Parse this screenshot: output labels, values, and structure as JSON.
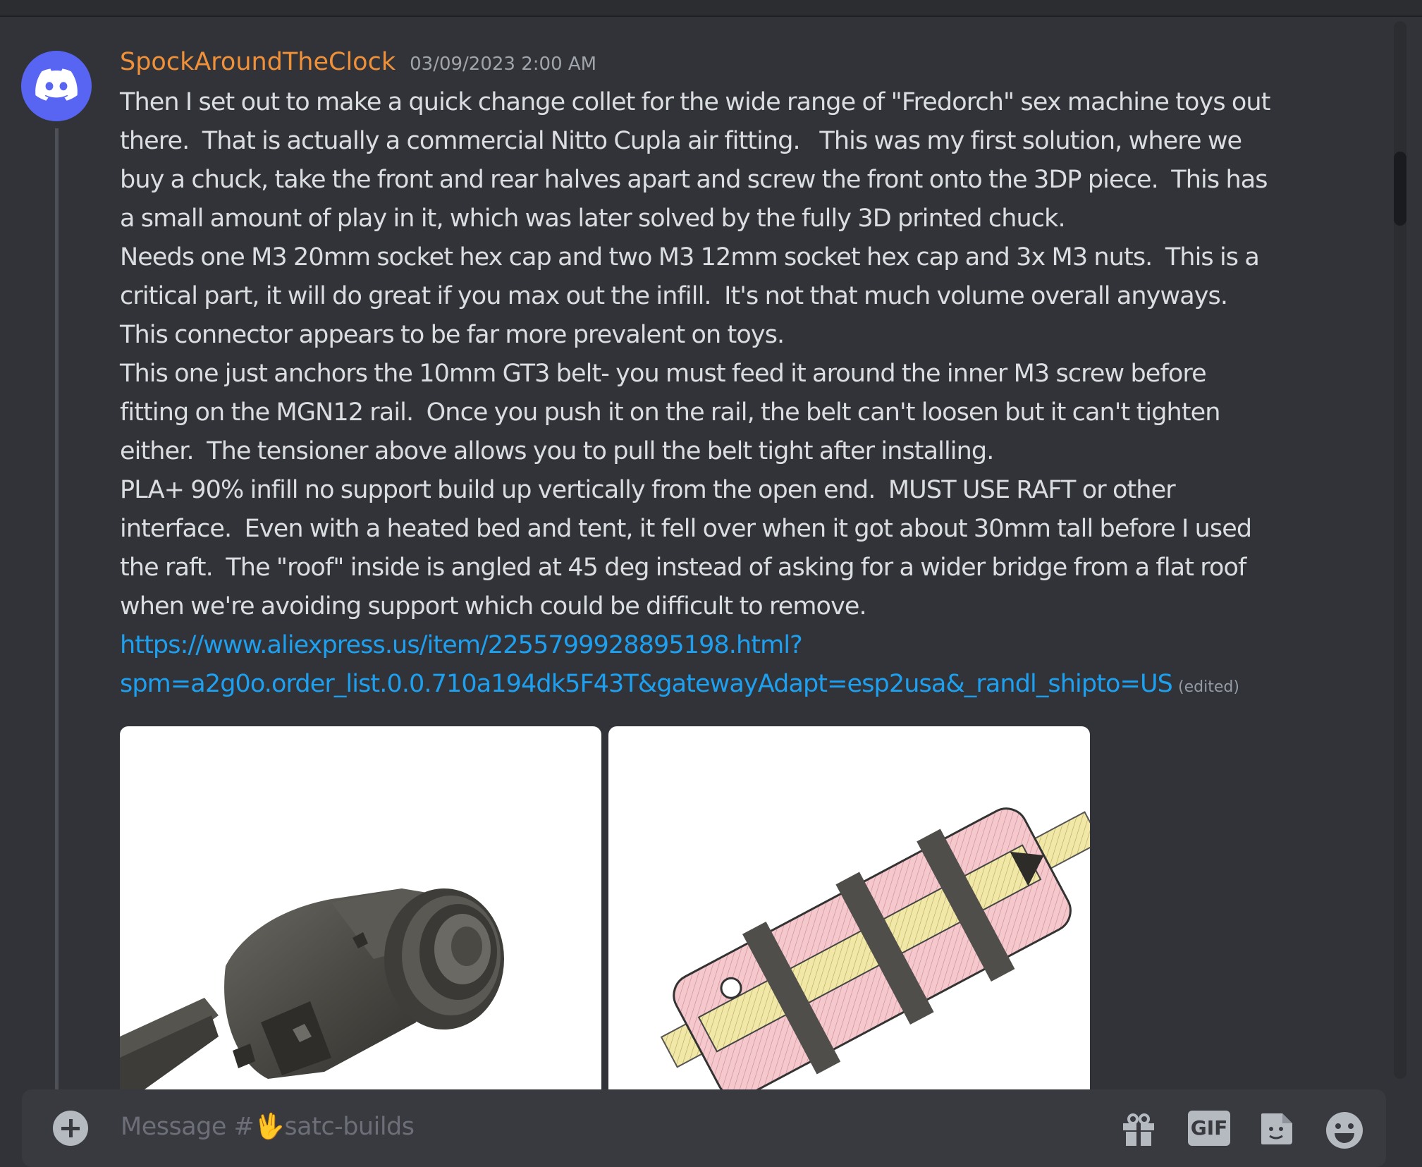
{
  "channel": {
    "name": "satc-builds",
    "placeholder": "Message #🖖satc-builds"
  },
  "message": {
    "author": "SpockAroundTheClock",
    "timestamp": "03/09/2023 2:00 AM",
    "lines": [
      "Then I set out to make a quick change collet for the wide range of \"Fredorch\" sex machine toys out",
      "there.  That is actually a commercial Nitto Cupla air fitting.   This was my first solution, where we",
      "buy a chuck, take the front and rear halves apart and screw the front onto the 3DP piece.  This has",
      "a small amount of play in it, which was later solved by the fully 3D printed chuck.",
      "Needs one M3 20mm socket hex cap and two M3 12mm socket hex cap and 3x M3 nuts.  This is a",
      "critical part, it will do great if you max out the infill.  It's not that much volume overall anyways.",
      "This connector appears to be far more prevalent on toys.",
      "This one just anchors the 10mm GT3 belt- you must feed it around the inner M3 screw before",
      "fitting on the MGN12 rail.  Once you push it on the rail, the belt can't loosen but it can't tighten",
      "either.  The tensioner above allows you to pull the belt tight after installing.",
      "PLA+ 90% infill no support build up vertically from the open end.  MUST USE RAFT or other",
      "interface.  Even with a heated bed and tent, it fell over when it got about 30mm tall before I used",
      "the raft.  The \"roof\" inside is angled at 45 deg instead of asking for a wider bridge from a flat roof",
      "when we're avoiding support which could be difficult to remove."
    ],
    "link_line1": "https://www.aliexpress.us/item/2255799928895198.html?",
    "link_line2": "spm=a2g0o.order_list.0.0.710a194dk5F43T&gatewayAdapt=esp2usa&_randl_shipto=US",
    "edited": "(edited)"
  },
  "composer": {
    "gif_label": "GIF",
    "icons": [
      "plus-circle-icon",
      "gift-icon",
      "gif-icon",
      "sticker-icon",
      "emoji-icon"
    ]
  },
  "colors": {
    "background": "#313338",
    "username": "#f0913a",
    "link": "#1ea0f0",
    "text": "#dbdee1",
    "avatar": "#5865f2"
  }
}
